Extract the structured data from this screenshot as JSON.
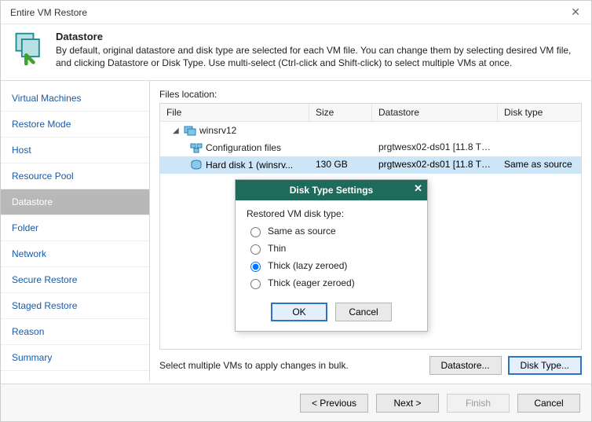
{
  "window": {
    "title": "Entire VM Restore"
  },
  "header": {
    "title": "Datastore",
    "description": "By default, original datastore and disk type are selected for each VM file. You can change them by selecting desired VM file, and clicking Datastore or Disk Type. Use multi-select (Ctrl-click and Shift-click) to select multiple VMs at once."
  },
  "sidebar": {
    "items": [
      "Virtual Machines",
      "Restore Mode",
      "Host",
      "Resource Pool",
      "Datastore",
      "Folder",
      "Network",
      "Secure Restore",
      "Staged Restore",
      "Reason",
      "Summary"
    ],
    "active_index": 4
  },
  "main": {
    "location_label": "Files location:",
    "columns": [
      "File",
      "Size",
      "Datastore",
      "Disk type"
    ],
    "rows": [
      {
        "file": "winsrv12",
        "size": "",
        "datastore": "",
        "disktype": "",
        "level": 1,
        "icon": "vm",
        "expander": true
      },
      {
        "file": "Configuration files",
        "size": "",
        "datastore": "prgtwesx02-ds01 [11.8 TB...",
        "disktype": "",
        "level": 2,
        "icon": "cfg"
      },
      {
        "file": "Hard disk 1 (winsrv...",
        "size": "130 GB",
        "datastore": "prgtwesx02-ds01 [11.8 TB...",
        "disktype": "Same as source",
        "level": 2,
        "icon": "disk",
        "selected": true
      }
    ],
    "hint": "Select multiple VMs to apply changes in bulk.",
    "buttons": {
      "datastore": "Datastore...",
      "disktype": "Disk Type..."
    }
  },
  "modal": {
    "title": "Disk Type Settings",
    "label": "Restored VM disk type:",
    "options": [
      "Same as source",
      "Thin",
      "Thick (lazy zeroed)",
      "Thick (eager zeroed)"
    ],
    "selected_index": 2,
    "ok": "OK",
    "cancel": "Cancel"
  },
  "footer": {
    "previous": "< Previous",
    "next": "Next >",
    "finish": "Finish",
    "cancel": "Cancel"
  }
}
